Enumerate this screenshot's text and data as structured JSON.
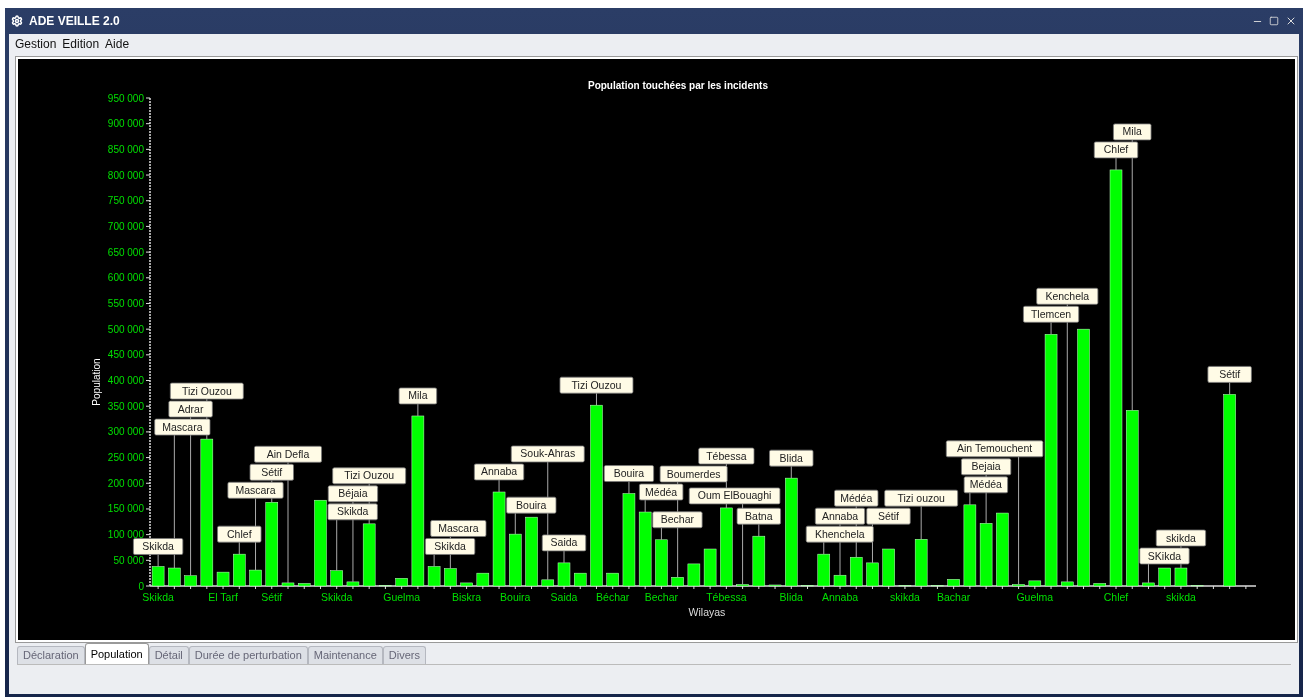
{
  "window": {
    "title": "ADE VEILLE 2.0"
  },
  "menu": [
    "Gestion",
    "Edition",
    "Aide"
  ],
  "chart": {
    "chart_data": {
      "type": "bar",
      "title": "Population touchées par les incidents",
      "xlabel": "Wilayas",
      "ylabel": "Population",
      "ylim": [
        0,
        950000
      ],
      "yticks": [
        {
          "value": 0,
          "label": "0"
        },
        {
          "value": 50000,
          "label": "50 000"
        },
        {
          "value": 100000,
          "label": "100 000"
        },
        {
          "value": 150000,
          "label": "150 000"
        },
        {
          "value": 200000,
          "label": "200 000"
        },
        {
          "value": 250000,
          "label": "250 000"
        },
        {
          "value": 300000,
          "label": "300 000"
        },
        {
          "value": 350000,
          "label": "350 000"
        },
        {
          "value": 400000,
          "label": "400 000"
        },
        {
          "value": 450000,
          "label": "450 000"
        },
        {
          "value": 500000,
          "label": "500 000"
        },
        {
          "value": 550000,
          "label": "550 000"
        },
        {
          "value": 600000,
          "label": "600 000"
        },
        {
          "value": 650000,
          "label": "650 000"
        },
        {
          "value": 700000,
          "label": "700 000"
        },
        {
          "value": 750000,
          "label": "750 000"
        },
        {
          "value": 800000,
          "label": "800 000"
        },
        {
          "value": 850000,
          "label": "850 000"
        },
        {
          "value": 900000,
          "label": "900 000"
        },
        {
          "value": 950000,
          "label": "950 000"
        }
      ],
      "categories": [
        "Skikda",
        null,
        null,
        null,
        "El Tarf",
        null,
        null,
        "Sétif",
        null,
        null,
        null,
        "Skikda",
        null,
        null,
        null,
        "Guelma",
        null,
        null,
        null,
        "Biskra",
        null,
        null,
        "Bouira",
        null,
        null,
        "Saida",
        null,
        null,
        "Béchar",
        null,
        null,
        "Bechar",
        null,
        null,
        null,
        "Tébessa",
        null,
        null,
        null,
        "Blida",
        null,
        null,
        "Annaba",
        null,
        null,
        null,
        "skikda",
        null,
        null,
        "Bachar",
        null,
        null,
        null,
        null,
        "Guelma",
        null,
        null,
        null,
        null,
        "Chlef",
        null,
        null,
        null,
        "skikda",
        null,
        null,
        null,
        null
      ],
      "series": [
        {
          "color": "#00ff00",
          "values": [
            38000,
            35000,
            20000,
            286000,
            27000,
            62000,
            31000,
            163000,
            6000,
            5000,
            167000,
            30000,
            8000,
            121000,
            1000,
            15000,
            331000,
            38000,
            34000,
            6000,
            25000,
            183000,
            101000,
            134000,
            12000,
            45000,
            25000,
            352000,
            25000,
            180000,
            144000,
            90000,
            17000,
            43000,
            72000,
            152000,
            3000,
            97000,
            2000,
            210000,
            1000,
            62000,
            21000,
            56000,
            45000,
            72000,
            1000,
            91000,
            1000,
            13000,
            158000,
            122000,
            142000,
            3000,
            10000,
            490000,
            8000,
            500000,
            5000,
            810000,
            342000,
            6000,
            35000,
            35000,
            1000,
            0,
            373000,
            0
          ]
        }
      ],
      "value_labels": [
        "Skikda",
        "Mascara",
        "Adrar",
        "Tizi Ouzou",
        null,
        "Chlef",
        "Mascara",
        "Sétif",
        "Ain Defla",
        null,
        null,
        "Skikda",
        "Béjaia",
        "Tizi Ouzou",
        null,
        null,
        "Mila",
        "Skikda",
        "Mascara",
        null,
        null,
        "Annaba",
        "Bouira",
        null,
        "Souk-Ahras",
        "Saida",
        null,
        "Tizi Ouzou",
        null,
        "Bouira",
        "Médéa",
        "Bechar",
        "Boumerdes",
        null,
        null,
        "Tébessa",
        "Oum ElBouaghi",
        "Batna",
        null,
        "Blida",
        null,
        "Khenchela",
        "Annaba",
        "Médéa",
        "Sétif",
        null,
        null,
        "Tizi ouzou",
        null,
        null,
        "Médéa",
        "Bejaia",
        null,
        "Ain Temouchent",
        null,
        "Tlemcen",
        "Kenchela",
        null,
        null,
        "Chlef",
        "Mila",
        "SKikda",
        null,
        "skikda",
        null,
        null,
        "Sétif",
        null
      ]
    }
  },
  "tabs": [
    {
      "label": "Déclaration",
      "selected": false
    },
    {
      "label": "Population",
      "selected": true
    },
    {
      "label": "Détail",
      "selected": false
    },
    {
      "label": "Durée de perturbation",
      "selected": false
    },
    {
      "label": "Maintenance",
      "selected": false
    },
    {
      "label": "Divers",
      "selected": false
    }
  ]
}
